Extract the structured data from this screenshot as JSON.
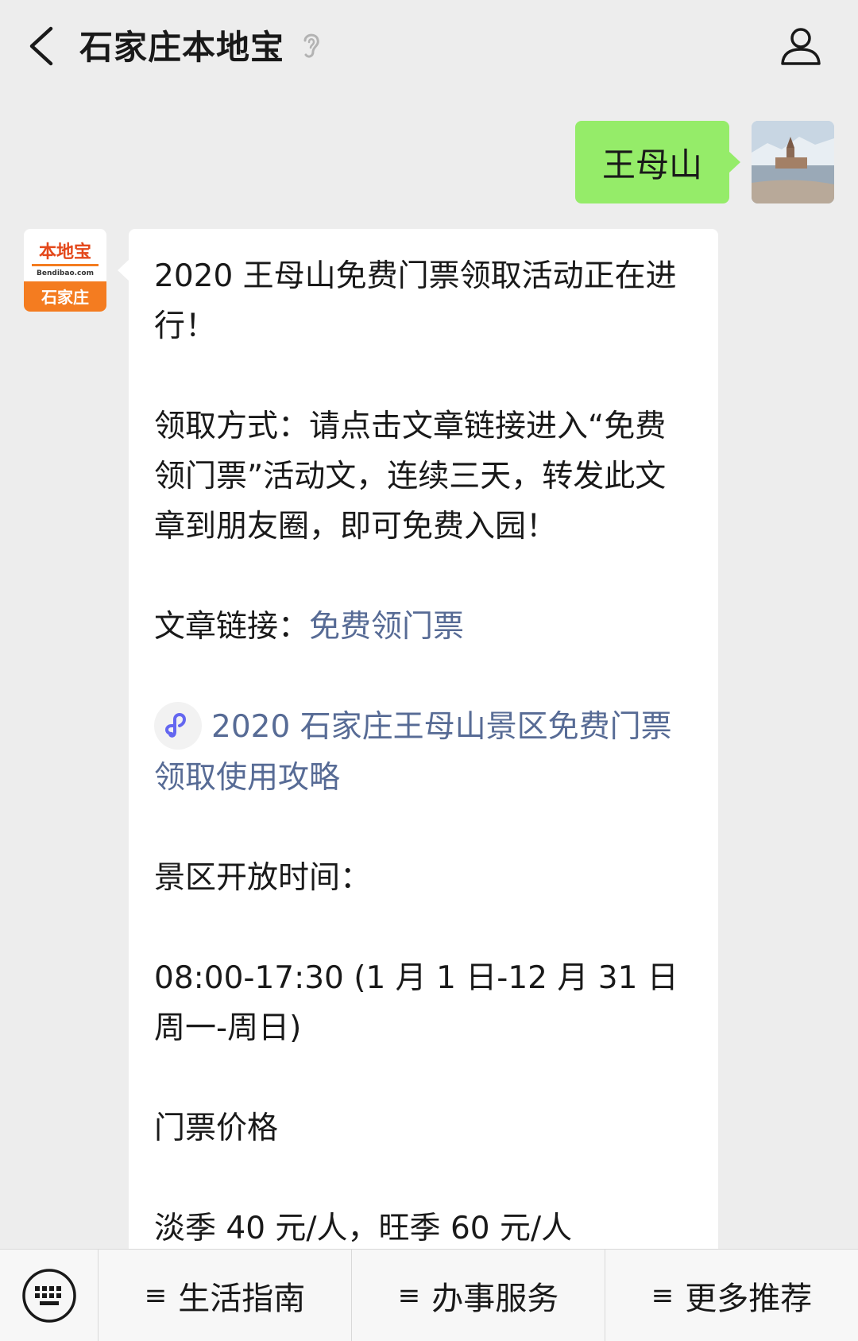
{
  "header": {
    "title": "石家庄本地宝",
    "icons": [
      "back-icon",
      "ear-icon",
      "profile-icon"
    ]
  },
  "chat": {
    "outgoing": {
      "text": "王母山"
    },
    "sender_logo": {
      "brand": "本地宝",
      "domain": "Bendibao.com",
      "city": "石家庄",
      "color": "#f47c20"
    },
    "incoming": {
      "paragraphs": [
        "2020 王母山免费门票领取活动正在进行！",
        "领取方式：请点击文章链接进入“免费领门票”活动文，连续三天，转发此文章到朋友圈，即可免费入园！"
      ],
      "article_label": "文章链接：",
      "article_link": "免费领门票",
      "mini_program_link": "2020 石家庄王母山景区免费门票领取使用攻略",
      "hours_title": "景区开放时间：",
      "hours": "08:00-17:30 (1 月 1 日-12 月 31 日 周一-周日)",
      "price_title": "门票价格",
      "price": "淡季 40 元/人，旺季 60 元/人"
    }
  },
  "bottom_menu": {
    "items": [
      "生活指南",
      "办事服务",
      "更多推荐"
    ],
    "prefix": "≡"
  },
  "colors": {
    "outgoing_bubble": "#95ec69",
    "link": "#576b95",
    "background": "#ededed"
  }
}
